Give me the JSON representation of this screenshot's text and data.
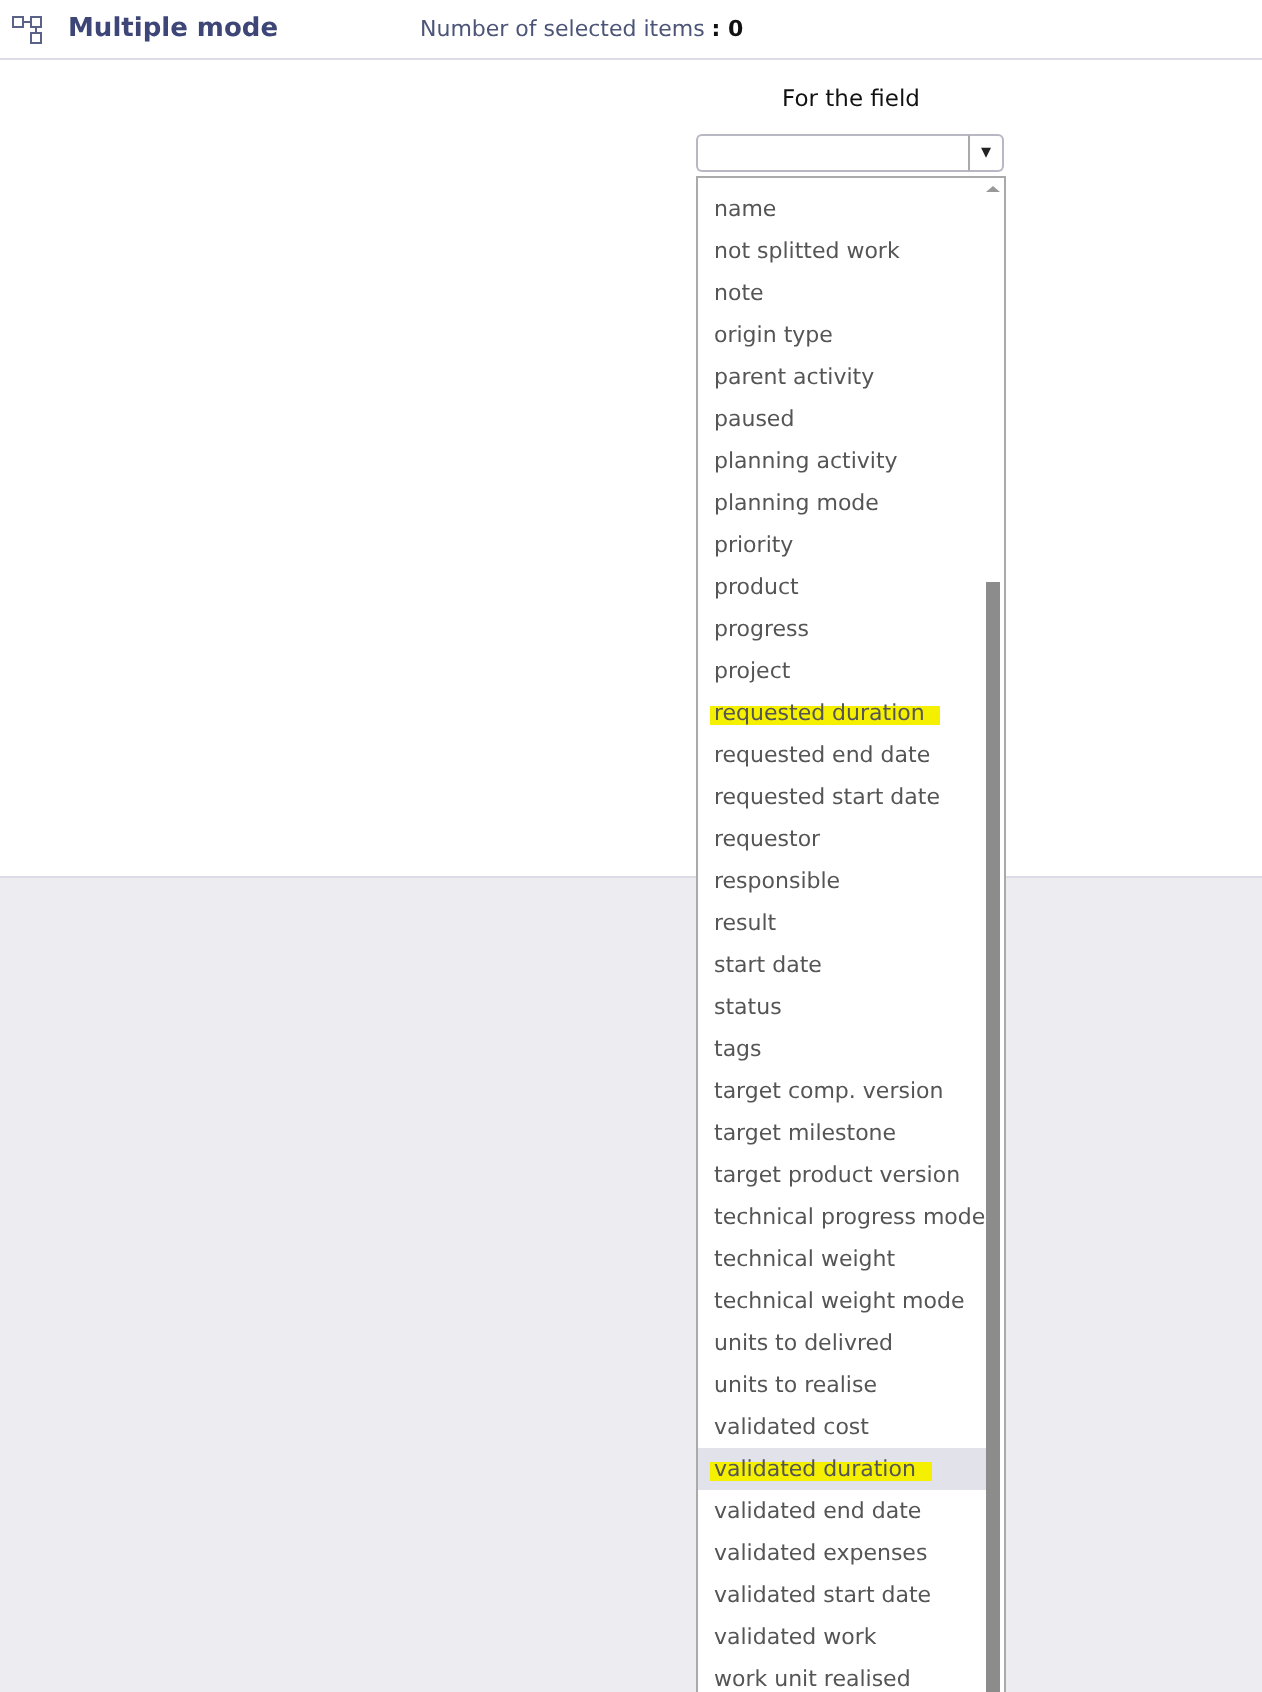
{
  "header": {
    "title": "Multiple mode",
    "count_label": "Number of selected items",
    "count_separator": ":",
    "count": "0"
  },
  "field_picker": {
    "label": "For the field",
    "arrow": "▾"
  },
  "options": [
    {
      "label": "name",
      "selected": false,
      "highlighted": false
    },
    {
      "label": "not splitted work",
      "selected": false,
      "highlighted": false
    },
    {
      "label": "note",
      "selected": false,
      "highlighted": false
    },
    {
      "label": "origin type",
      "selected": false,
      "highlighted": false
    },
    {
      "label": "parent activity",
      "selected": false,
      "highlighted": false
    },
    {
      "label": "paused",
      "selected": false,
      "highlighted": false
    },
    {
      "label": "planning activity",
      "selected": false,
      "highlighted": false
    },
    {
      "label": "planning mode",
      "selected": false,
      "highlighted": false
    },
    {
      "label": "priority",
      "selected": false,
      "highlighted": false
    },
    {
      "label": "product",
      "selected": false,
      "highlighted": false
    },
    {
      "label": "progress",
      "selected": false,
      "highlighted": false
    },
    {
      "label": "project",
      "selected": false,
      "highlighted": false
    },
    {
      "label": "requested duration",
      "selected": false,
      "highlighted": true
    },
    {
      "label": "requested end date",
      "selected": false,
      "highlighted": false
    },
    {
      "label": "requested start date",
      "selected": false,
      "highlighted": false
    },
    {
      "label": "requestor",
      "selected": false,
      "highlighted": false
    },
    {
      "label": "responsible",
      "selected": false,
      "highlighted": false
    },
    {
      "label": "result",
      "selected": false,
      "highlighted": false
    },
    {
      "label": "start date",
      "selected": false,
      "highlighted": false
    },
    {
      "label": "status",
      "selected": false,
      "highlighted": false
    },
    {
      "label": "tags",
      "selected": false,
      "highlighted": false
    },
    {
      "label": "target comp. version",
      "selected": false,
      "highlighted": false
    },
    {
      "label": "target milestone",
      "selected": false,
      "highlighted": false
    },
    {
      "label": "target product version",
      "selected": false,
      "highlighted": false
    },
    {
      "label": "technical progress mode",
      "selected": false,
      "highlighted": false
    },
    {
      "label": "technical weight",
      "selected": false,
      "highlighted": false
    },
    {
      "label": "technical weight mode",
      "selected": false,
      "highlighted": false
    },
    {
      "label": "units to delivred",
      "selected": false,
      "highlighted": false
    },
    {
      "label": "units to realise",
      "selected": false,
      "highlighted": false
    },
    {
      "label": "validated cost",
      "selected": false,
      "highlighted": false
    },
    {
      "label": "validated duration",
      "selected": true,
      "highlighted": true
    },
    {
      "label": "validated end date",
      "selected": false,
      "highlighted": false
    },
    {
      "label": "validated expenses",
      "selected": false,
      "highlighted": false
    },
    {
      "label": "validated start date",
      "selected": false,
      "highlighted": false
    },
    {
      "label": "validated work",
      "selected": false,
      "highlighted": false
    },
    {
      "label": "work unit realised",
      "selected": false,
      "highlighted": false
    }
  ]
}
